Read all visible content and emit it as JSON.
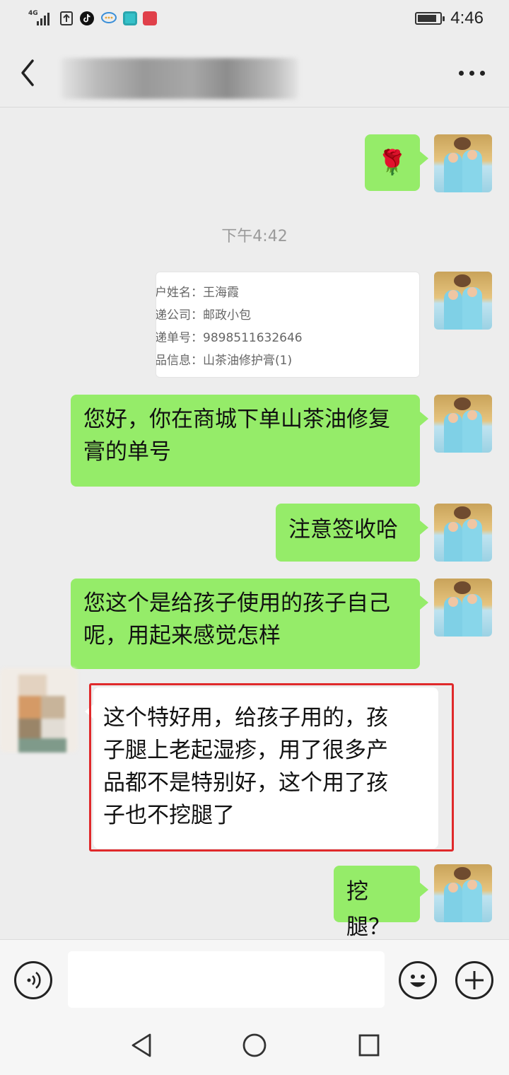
{
  "status_bar": {
    "network": "4G",
    "time": "4:46",
    "colors": {
      "tiktok": "#111111",
      "app_cyan": "#35c1c9",
      "app_red": "#e0404a"
    },
    "icons": [
      "upload-icon",
      "tiktok-icon",
      "chat-icon",
      "app-icon",
      "huawei-store-icon"
    ]
  },
  "header": {
    "icons": {
      "back": "chevron-left-icon",
      "more": "more-dots-icon"
    }
  },
  "messages": {
    "rose": "🌹",
    "timestamp": "下午4:42",
    "order_card": {
      "rows": [
        {
          "key": "户姓名：",
          "value": "王海霞"
        },
        {
          "key": "递公司：",
          "value": "邮政小包"
        },
        {
          "key": "递单号：",
          "value": "9898511632646"
        },
        {
          "key": "品信息：",
          "value": "山茶油修护膏(1)"
        }
      ]
    },
    "m1_line1": "您好，你在商城下单山茶油修复",
    "m1_line2": "膏的单号",
    "m2": "注意签收哈",
    "m3_line1": "您这个是给孩子使用的孩子自己",
    "m3_line2": "呢，用起来感觉怎样",
    "m4_line1": "这个特好用，给孩子用的，孩",
    "m4_line2": "子腿上老起湿疹，用了很多产",
    "m4_line3": "品都不是特别好，这个用了孩",
    "m4_line4": "子也不挖腿了",
    "m5": "挖腿？"
  },
  "input_bar": {
    "placeholder": "",
    "icons": {
      "voice": "voice-icon",
      "emoji": "emoji-icon",
      "plus": "plus-icon"
    }
  },
  "nav_bar": {
    "icons": {
      "back": "triangle-back-icon",
      "home": "circle-home-icon",
      "recent": "square-recent-icon"
    }
  },
  "colors": {
    "sent_bubble": "#95ec69",
    "received_bubble": "#ffffff",
    "background": "#ededed",
    "highlight": "#e0292b"
  }
}
